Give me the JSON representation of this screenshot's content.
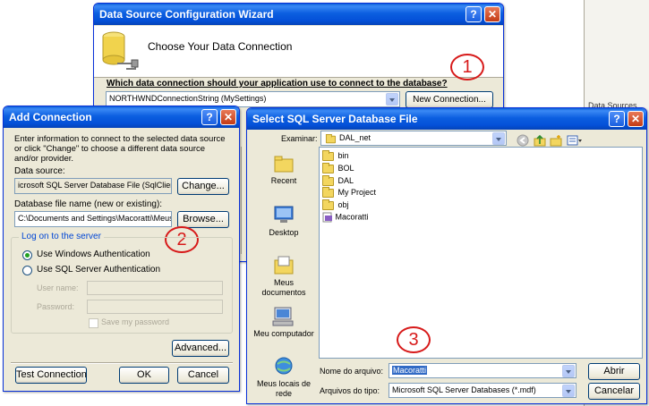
{
  "background_panel": {
    "label": "Data Sources"
  },
  "wizard": {
    "title": "Data Source Configuration Wizard",
    "heading": "Choose Your Data Connection",
    "question": "Which data connection should your application use to connect to the database?",
    "connection_value": "NORTHWNDConnectionString (MySettings)",
    "new_connection_label": "New Connection...",
    "help_symbol": "?",
    "close_symbol": "✕"
  },
  "add_connection": {
    "title": "Add Connection",
    "intro": "Enter information to connect to the selected data source or click \"Change\" to choose a different data source and/or provider.",
    "data_source_label": "Data source:",
    "data_source_value": "icrosoft SQL Server Database File (SqlClient)",
    "change_label": "Change...",
    "db_file_label": "Database file name (new or existing):",
    "db_file_value": "C:\\Documents and Settings\\Macoratti\\Meus d",
    "browse_label": "Browse...",
    "logon_group": "Log on to the server",
    "windows_auth": "Use Windows Authentication",
    "sql_auth": "Use SQL Server Authentication",
    "user_name_label": "User name:",
    "password_label": "Password:",
    "save_password": "Save my password",
    "advanced_label": "Advanced...",
    "test_label": "Test Connection",
    "ok_label": "OK",
    "cancel_label": "Cancel",
    "help_symbol": "?",
    "close_symbol": "✕"
  },
  "file_dialog": {
    "title": "Select SQL Server Database File",
    "look_in_label": "Examinar:",
    "look_in_value": "DAL_net",
    "places": [
      {
        "label": "Recent"
      },
      {
        "label": "Desktop"
      },
      {
        "label": "Meus documentos"
      },
      {
        "label": "Meu computador"
      },
      {
        "label": "Meus locais de rede"
      }
    ],
    "files": [
      {
        "name": "bin",
        "kind": "folder"
      },
      {
        "name": "BOL",
        "kind": "folder"
      },
      {
        "name": "DAL",
        "kind": "folder"
      },
      {
        "name": "My Project",
        "kind": "folder"
      },
      {
        "name": "obj",
        "kind": "folder"
      },
      {
        "name": "Macoratti",
        "kind": "project"
      }
    ],
    "file_name_label": "Nome do arquivo:",
    "file_name_value": "Macoratti",
    "file_type_label": "Arquivos do tipo:",
    "file_type_value": "Microsoft SQL Server Databases (*.mdf)",
    "open_label": "Abrir",
    "cancel_label": "Cancelar",
    "help_symbol": "?",
    "close_symbol": "✕"
  },
  "annotations": {
    "one": "1",
    "two": "2",
    "three": "3"
  },
  "colors": {
    "title_bar": "#0a5fd8",
    "annotation": "#d71a1a",
    "dialog_face": "#ece9d8"
  }
}
